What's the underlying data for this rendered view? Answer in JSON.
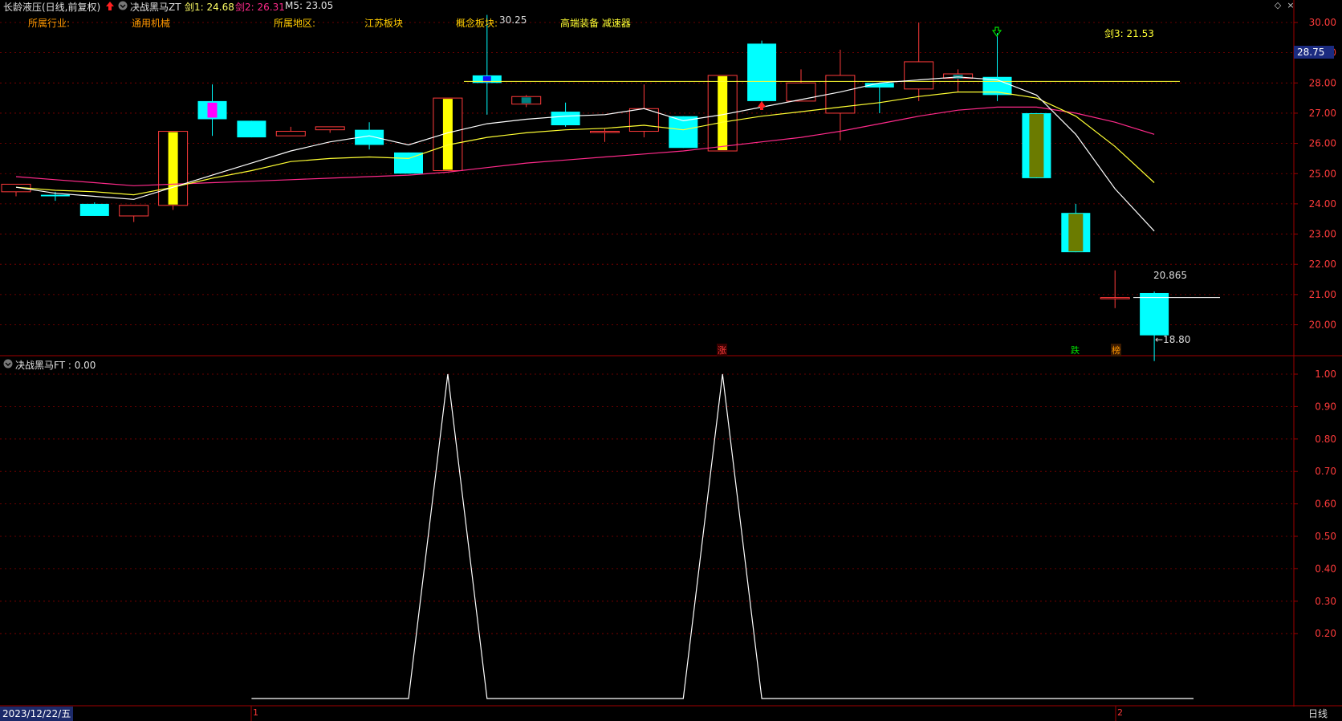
{
  "header": {
    "stock_title": "长龄液压(日线,前复权)",
    "indicator_name": "决战黑马ZT",
    "jian1": "剑1: 24.68",
    "jian2": "剑2: 26.31",
    "m5": "M5: 23.05",
    "industry_label": "所属行业:",
    "industry_value": "通用机械",
    "region_label": "所属地区:",
    "region_value": "江苏板块",
    "concept_label": "概念板块:",
    "concept_value": "高端装备 减速器",
    "jian3": "剑3: 21.53"
  },
  "lower_header": {
    "indicator_label": "决战黑马FT : 0.00"
  },
  "footer": {
    "date": "2023/12/22/五",
    "marker_1": "1",
    "marker_2": "2",
    "period": "日线"
  },
  "annotations": {
    "high_label": "30.25",
    "low_label": "←18.80",
    "close_label": "20.865",
    "current_price": "28.75",
    "zhang": "涨",
    "die": "跌",
    "bang": "榜"
  },
  "colors": {
    "up": "#ff3b3b",
    "down": "#00ffff",
    "grid": "#8b0000",
    "ma_white": "#ffffff",
    "ma_yellow": "#ffff33",
    "ma_pink": "#ff2a8a",
    "text_yellow": "#ffcc00",
    "text_orange": "#ff9900"
  },
  "chart_data": [
    {
      "type": "candlestick",
      "title": "",
      "ylim": [
        18.5,
        30.3
      ],
      "yticks": [
        "30.00",
        "29.00",
        "28.00",
        "27.00",
        "26.00",
        "25.00",
        "24.00",
        "23.00",
        "22.00",
        "21.00",
        "20.00"
      ],
      "candles": [
        {
          "o": 24.4,
          "h": 24.65,
          "l": 24.25,
          "c": 24.65
        },
        {
          "o": 24.3,
          "h": 24.4,
          "l": 24.1,
          "c": 24.25
        },
        {
          "o": 24.0,
          "h": 24.05,
          "l": 23.6,
          "c": 23.6
        },
        {
          "o": 23.6,
          "h": 23.95,
          "l": 23.4,
          "c": 23.95
        },
        {
          "o": 23.95,
          "h": 26.4,
          "l": 23.8,
          "c": 26.4
        },
        {
          "o": 27.4,
          "h": 27.95,
          "l": 26.25,
          "c": 26.8
        },
        {
          "o": 26.75,
          "h": 26.75,
          "l": 26.2,
          "c": 26.2
        },
        {
          "o": 26.25,
          "h": 26.55,
          "l": 26.25,
          "c": 26.4
        },
        {
          "o": 26.45,
          "h": 26.55,
          "l": 26.35,
          "c": 26.55
        },
        {
          "o": 26.45,
          "h": 26.7,
          "l": 25.8,
          "c": 25.95
        },
        {
          "o": 25.7,
          "h": 25.7,
          "l": 25.0,
          "c": 25.0
        },
        {
          "o": 25.1,
          "h": 27.5,
          "l": 25.1,
          "c": 27.5
        },
        {
          "o": 28.25,
          "h": 30.25,
          "l": 26.95,
          "c": 28.0
        },
        {
          "o": 27.3,
          "h": 27.6,
          "l": 27.2,
          "c": 27.55
        },
        {
          "o": 27.05,
          "h": 27.35,
          "l": 26.55,
          "c": 26.6
        },
        {
          "o": 26.4,
          "h": 26.5,
          "l": 26.05,
          "c": 26.4
        },
        {
          "o": 26.4,
          "h": 27.95,
          "l": 26.2,
          "c": 27.15
        },
        {
          "o": 26.9,
          "h": 26.9,
          "l": 25.85,
          "c": 25.85
        },
        {
          "o": 25.75,
          "h": 28.25,
          "l": 25.75,
          "c": 28.25
        },
        {
          "o": 29.3,
          "h": 29.4,
          "l": 27.3,
          "c": 27.4
        },
        {
          "o": 27.4,
          "h": 28.45,
          "l": 27.4,
          "c": 28.0
        },
        {
          "o": 27.0,
          "h": 29.1,
          "l": 26.1,
          "c": 28.25
        },
        {
          "o": 28.0,
          "h": 28.0,
          "l": 27.0,
          "c": 27.85
        },
        {
          "o": 27.8,
          "h": 30.0,
          "l": 27.4,
          "c": 28.7
        },
        {
          "o": 28.15,
          "h": 28.45,
          "l": 27.7,
          "c": 28.3
        },
        {
          "o": 28.2,
          "h": 29.65,
          "l": 27.4,
          "c": 27.6
        },
        {
          "o": 27.0,
          "h": 27.0,
          "l": 24.85,
          "c": 24.85
        },
        {
          "o": 23.7,
          "h": 24.0,
          "l": 22.4,
          "c": 22.4
        },
        {
          "o": 20.9,
          "h": 21.8,
          "l": 20.55,
          "c": 20.9
        },
        {
          "o": 21.05,
          "h": 21.1,
          "l": 18.8,
          "c": 19.65
        }
      ],
      "ma_white": [
        24.55,
        24.35,
        24.25,
        24.15,
        24.55,
        24.95,
        25.35,
        25.75,
        26.05,
        26.25,
        25.95,
        26.35,
        26.65,
        26.8,
        26.9,
        26.95,
        27.15,
        26.75,
        26.95,
        27.2,
        27.45,
        27.7,
        28.0,
        28.1,
        28.2,
        28.1,
        27.6,
        26.3,
        24.5,
        23.1
      ],
      "ma_yellow": [
        24.55,
        24.45,
        24.4,
        24.3,
        24.55,
        24.85,
        25.1,
        25.4,
        25.5,
        25.55,
        25.5,
        25.95,
        26.2,
        26.35,
        26.45,
        26.5,
        26.6,
        26.45,
        26.7,
        26.9,
        27.05,
        27.2,
        27.35,
        27.55,
        27.7,
        27.7,
        27.5,
        26.9,
        25.9,
        24.7
      ],
      "ma_pink": [
        24.9,
        24.8,
        24.7,
        24.6,
        24.65,
        24.7,
        24.75,
        24.8,
        24.85,
        24.9,
        24.95,
        25.05,
        25.2,
        25.35,
        25.45,
        25.55,
        25.65,
        25.75,
        25.9,
        26.05,
        26.2,
        26.4,
        26.65,
        26.9,
        27.1,
        27.2,
        27.2,
        27.0,
        26.7,
        26.3
      ],
      "horizontal_line": 28.05
    },
    {
      "type": "line",
      "title": "",
      "ylim": [
        0,
        1.05
      ],
      "yticks": [
        "1.00",
        "0.90",
        "0.80",
        "0.70",
        "0.60",
        "0.50",
        "0.40",
        "0.30",
        "0.20"
      ],
      "x_start_index": 6,
      "values": [
        0,
        0,
        0,
        0,
        0,
        1,
        0,
        0,
        0,
        0,
        0,
        0,
        1,
        0,
        0,
        0,
        0,
        0,
        0,
        0,
        0,
        0,
        0,
        0,
        0
      ]
    }
  ]
}
